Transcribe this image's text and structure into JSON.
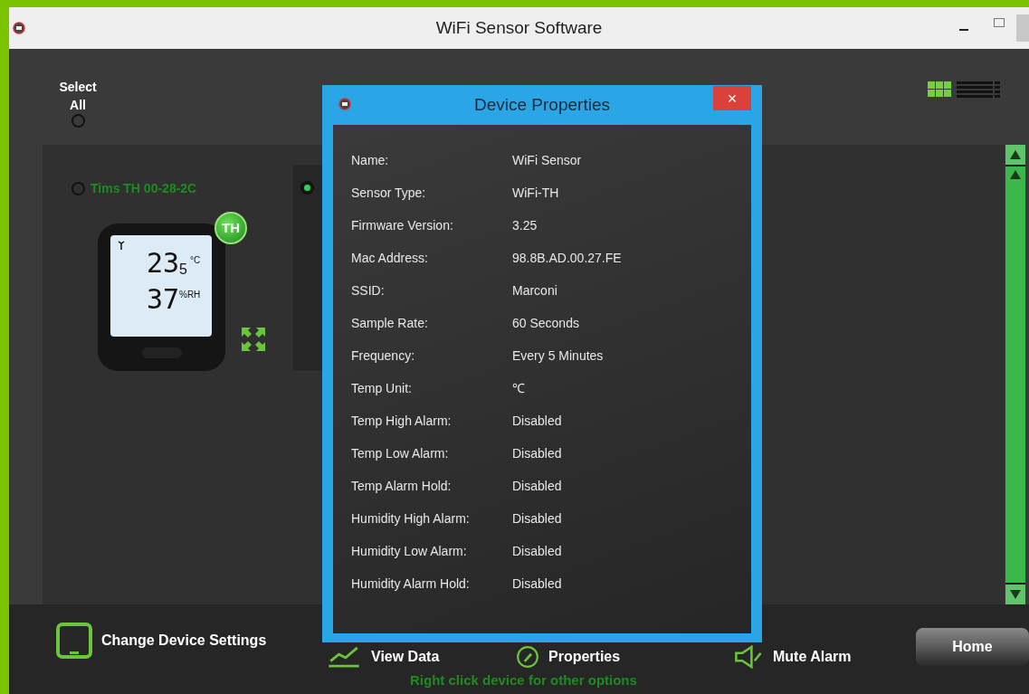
{
  "window": {
    "title": "WiFi Sensor Software"
  },
  "select_all": {
    "label": "Select All",
    "selected": false
  },
  "view_modes": [
    {
      "kind": "grid",
      "selected": true
    },
    {
      "kind": "list",
      "selected": false
    }
  ],
  "devices": [
    {
      "name": "Tims TH 00-28-2C",
      "selected": false,
      "badge": "TH",
      "temperature": "23",
      "temperature_decimal": "5",
      "temperature_unit": "°C",
      "humidity": "37",
      "humidity_unit": "%RH"
    },
    {
      "selected": true
    }
  ],
  "dialog": {
    "title": "Device Properties",
    "close": "×",
    "properties": [
      {
        "label": "Name:",
        "value": "WiFi Sensor"
      },
      {
        "label": "Sensor Type:",
        "value": "WiFi-TH"
      },
      {
        "label": "Firmware Version:",
        "value": "3.25"
      },
      {
        "label": "Mac Address:",
        "value": "98.8B.AD.00.27.FE"
      },
      {
        "label": "SSID:",
        "value": "Marconi"
      },
      {
        "label": "Sample Rate:",
        "value": "60 Seconds"
      },
      {
        "label": "Frequency:",
        "value": "Every 5 Minutes"
      },
      {
        "label": "Temp Unit:",
        "value": "℃"
      },
      {
        "label": "Temp High Alarm:",
        "value": "Disabled"
      },
      {
        "label": "Temp Low Alarm:",
        "value": "Disabled"
      },
      {
        "label": "Temp Alarm Hold:",
        "value": "Disabled"
      },
      {
        "label": "Humidity High Alarm:",
        "value": "Disabled"
      },
      {
        "label": "Humidity Low Alarm:",
        "value": "Disabled"
      },
      {
        "label": "Humidity Alarm Hold:",
        "value": "Disabled"
      }
    ]
  },
  "toolbar": [
    {
      "kind": "settings",
      "label": "Change Device Settings"
    },
    {
      "kind": "data",
      "label": "View Data"
    },
    {
      "kind": "properties",
      "label": "Properties"
    },
    {
      "kind": "alarm",
      "label": "Mute Alarm"
    }
  ],
  "hint": "Right click device for other options",
  "home_button": "Home"
}
